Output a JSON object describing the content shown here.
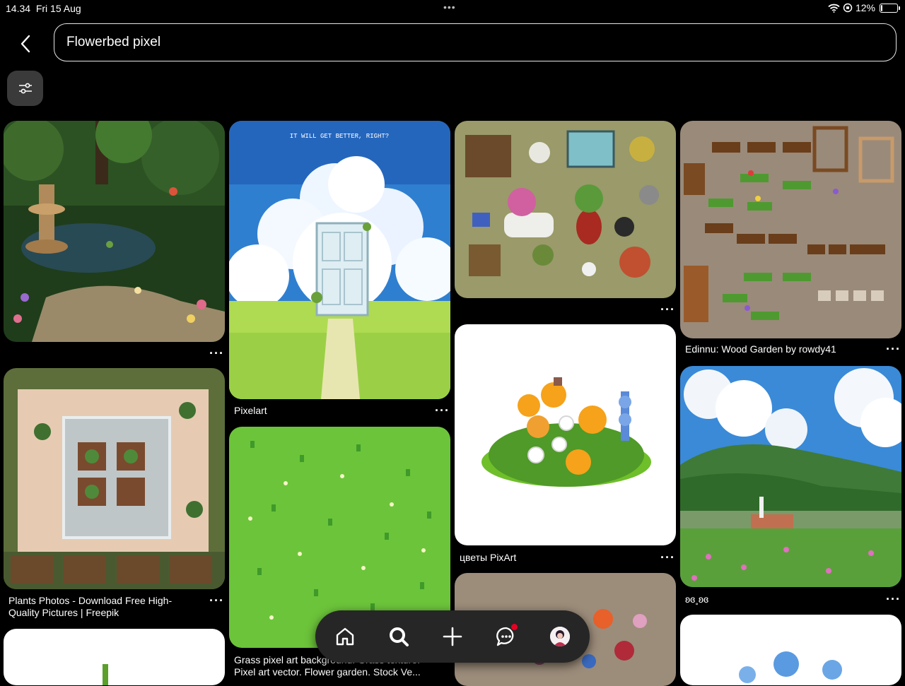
{
  "status": {
    "time": "14.34",
    "date": "Fri 15 Aug",
    "battery": "12%",
    "battery_level": 0.12
  },
  "search": {
    "query": "Flowerbed pixel"
  },
  "pins": [
    {
      "caption": ""
    },
    {
      "caption": "Pixelart"
    },
    {
      "caption": ""
    },
    {
      "caption": "Edinnu: Wood Garden by rowdy41"
    },
    {
      "caption": "Plants Photos - Download Free High-",
      "caption2": "Quality Pictures | Freepik"
    },
    {
      "caption": "Grass pixel art background. Grass texture.",
      "caption2": "Pixel art vector. Flower garden. Stock Ve..."
    },
    {
      "caption": "цветы PixArt"
    },
    {
      "caption": "ʚɞ˳ʚɞ"
    },
    {
      "image_text": "IT WILL GET BETTER, RIGHT?"
    }
  ],
  "icons": {
    "back": "chevron-left-icon",
    "filter": "sliders-icon",
    "more": "ellipsis-icon",
    "home": "home-icon",
    "search": "search-icon",
    "create": "plus-icon",
    "messages": "chat-icon",
    "profile": "avatar"
  },
  "colors": {
    "background": "#000000",
    "nav_bg": "#262626",
    "notification": "#e60023"
  }
}
